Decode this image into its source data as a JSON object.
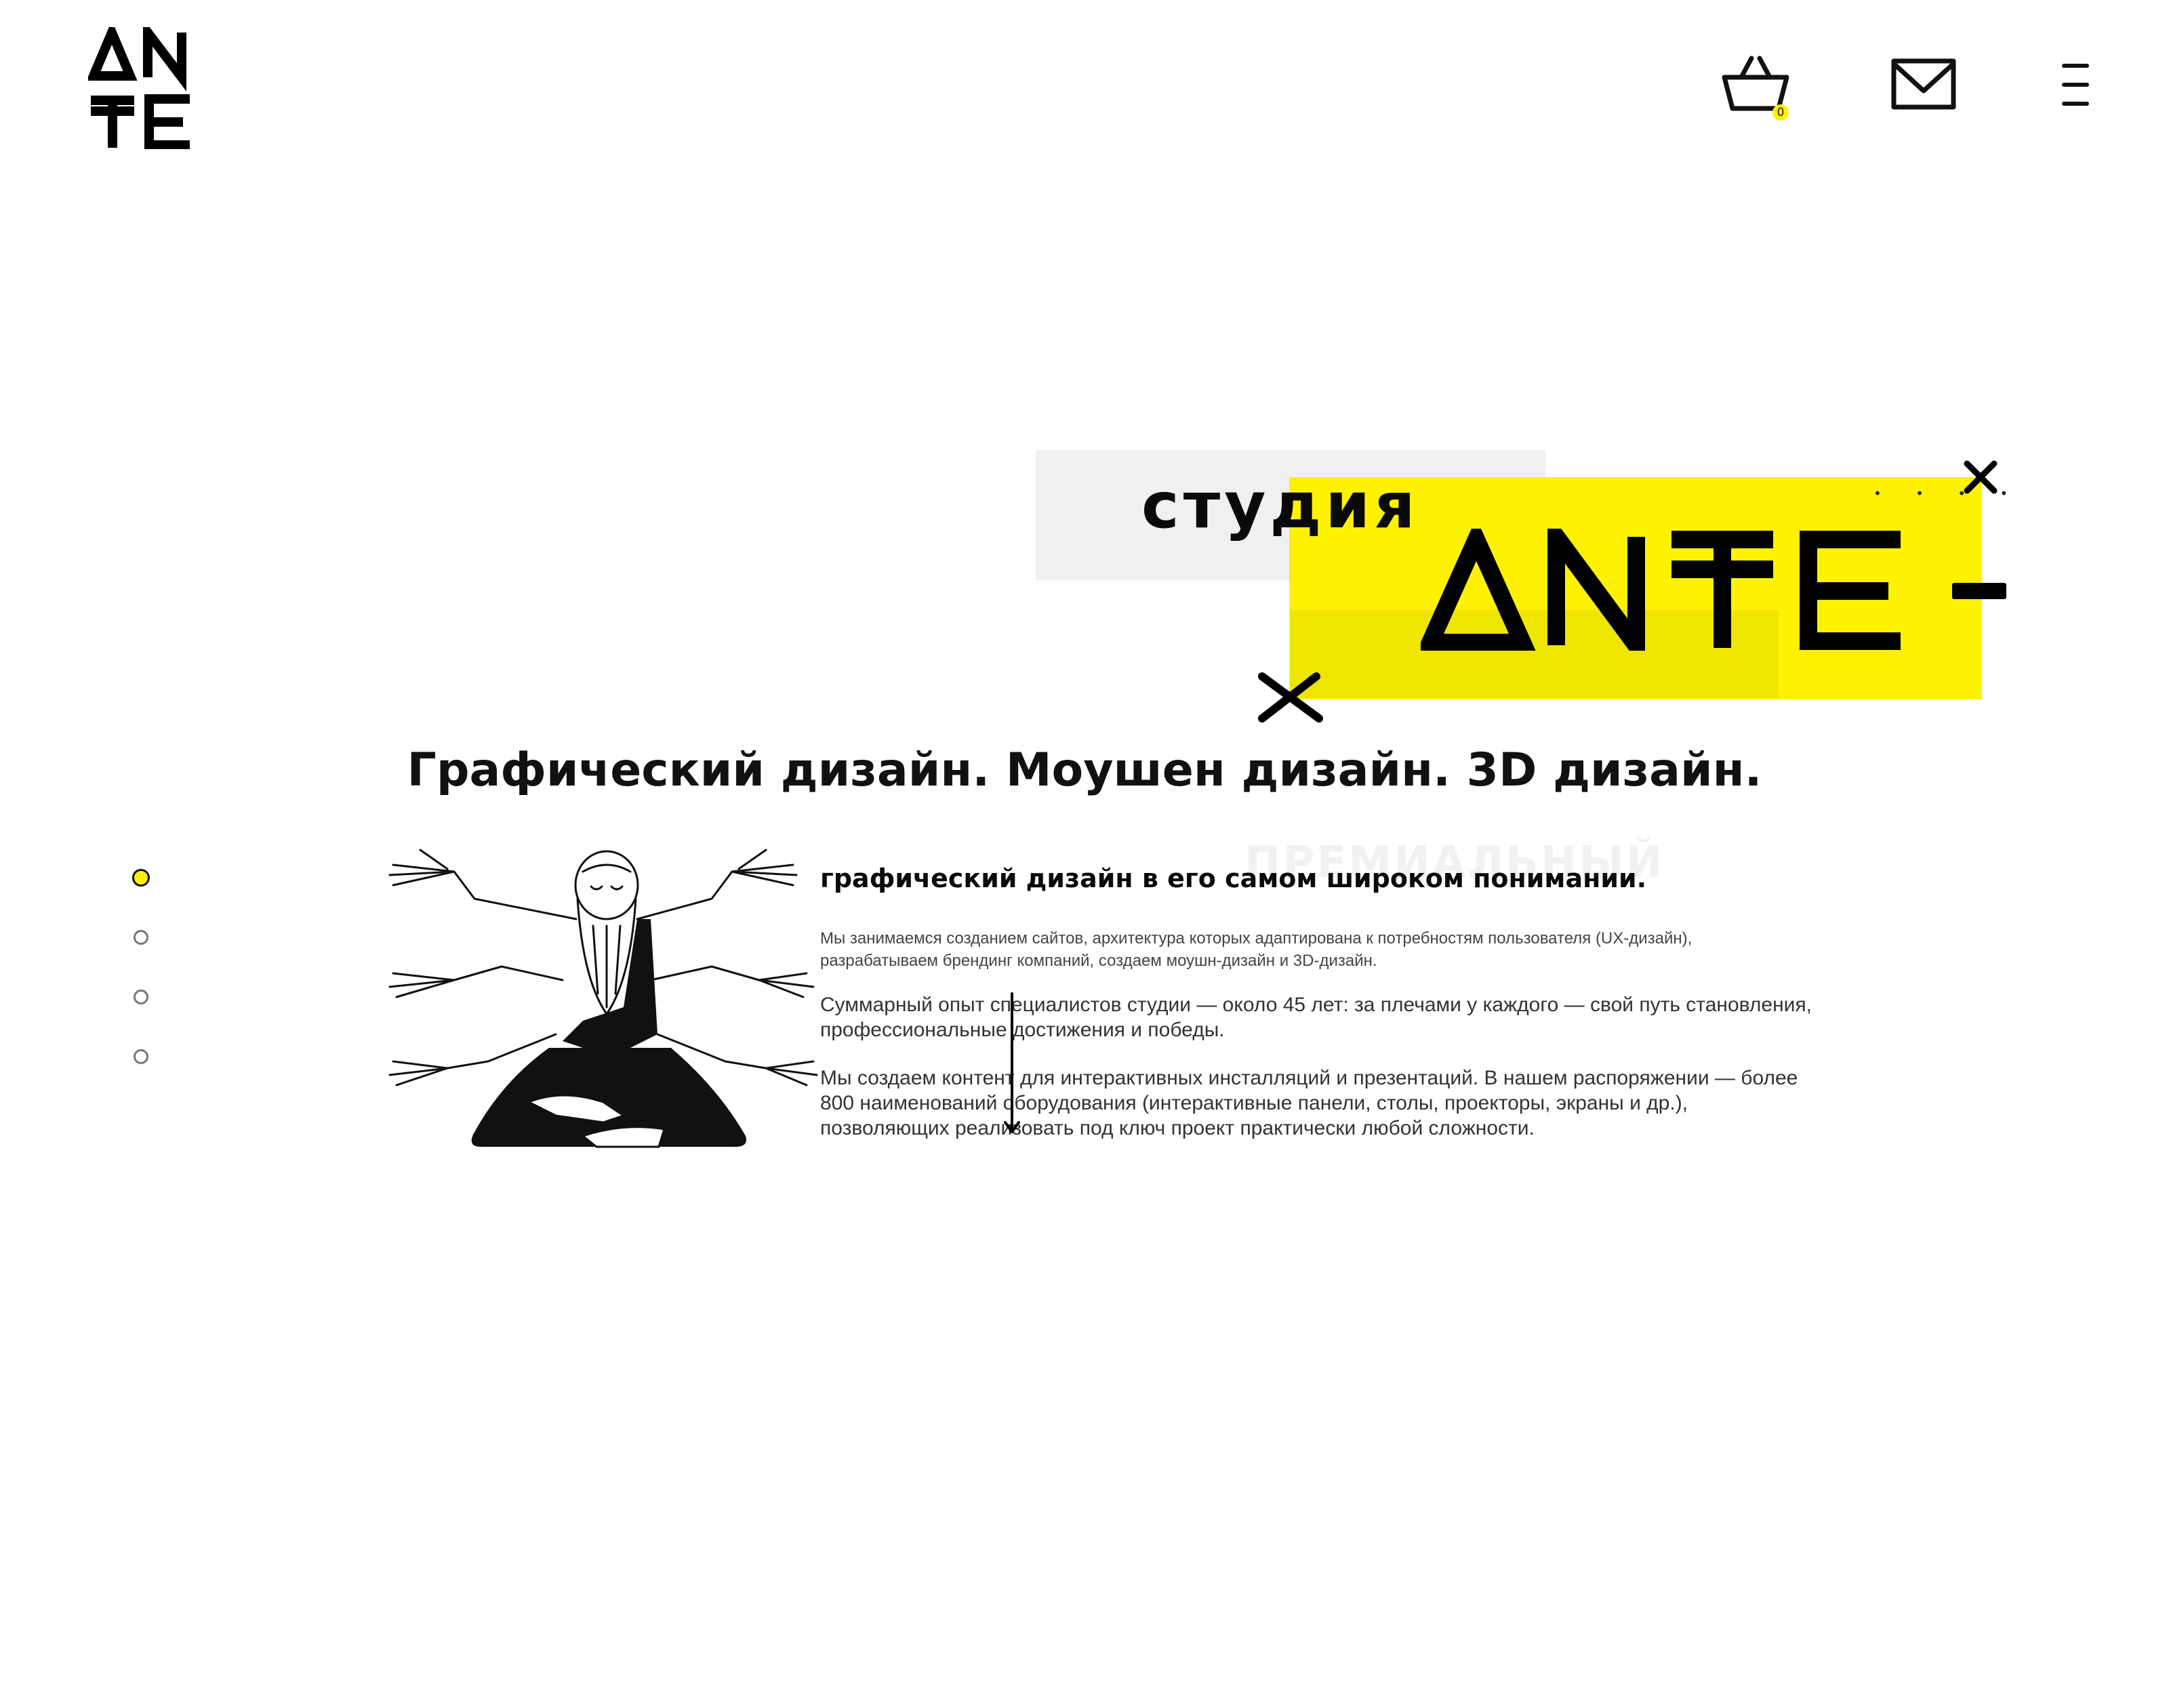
{
  "header": {
    "logo_text": "ANTE",
    "cart_count": "0",
    "icons": [
      "cart-icon",
      "mail-icon",
      "menu-icon"
    ]
  },
  "hero": {
    "studio_word": "студия",
    "brand": "ANTE",
    "dots": "• • • •",
    "tagline": "Графический дизайн. Моушен дизайн. 3D дизайн.",
    "ghost_word": "ПРЕМИАЛЬНЫЙ"
  },
  "slider": {
    "count": 4,
    "active_index": 0
  },
  "section": {
    "headline": "графический дизайн в его самом широком понимании.",
    "paragraphs": [
      "Мы занимаемся созданием сайтов, архитектура которых адаптирована к потребностям пользователя (UX-дизайн), разрабатываем брендинг компаний, создаем моушн-дизайн и 3D-дизайн.",
      "Суммарный опыт специалистов студии — около 45 лет: за плечами у каждого — свой путь становления, профессиональные достижения и победы.",
      "Мы создаем контент для интерактивных инсталляций и презентаций. В нашем распоряжении — более 800 наименований оборудования (интерактивные панели, столы, проекторы, экраны и др.), позволяющих реализовать под ключ проект практически любой сложности."
    ]
  },
  "colors": {
    "accent": "#fff200",
    "ink": "#111111",
    "panel": "#f0f0f0"
  }
}
